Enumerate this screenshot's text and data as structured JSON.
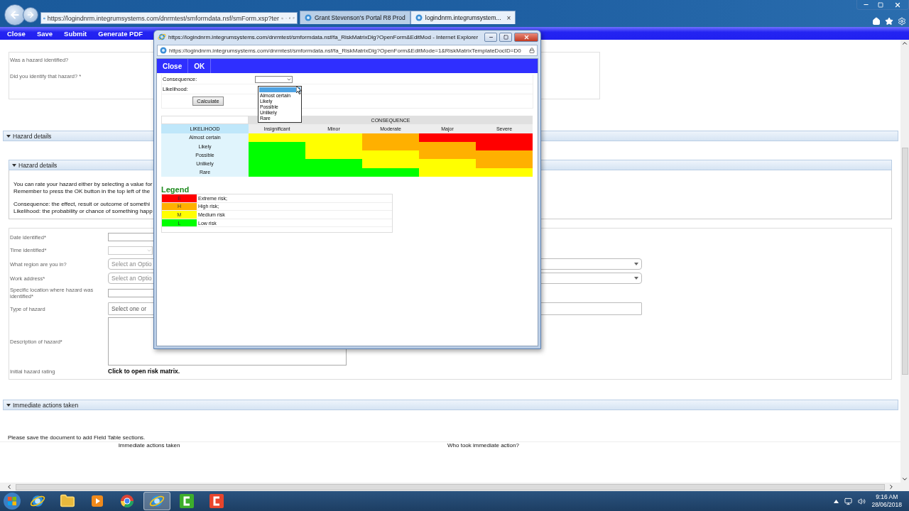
{
  "browser": {
    "address": "https://logindnrm.integrumsystems.com/dnrmtest/smformdata.nsf/smForm.xsp?ter",
    "tabs": [
      {
        "label": "Grant Stevenson's Portal R8 Prod",
        "selected": false
      },
      {
        "label": "logindnrm.integrumsystem...",
        "selected": true
      }
    ],
    "tab_close": "×"
  },
  "toolbar": [
    "Close",
    "Save",
    "Submit",
    "Generate PDF"
  ],
  "page": {
    "questions": [
      "Was a hazard identified?",
      "Did you identify that hazard? *"
    ],
    "section_title": "Hazard details",
    "subsection_title": "Hazard details",
    "help_lines": [
      "You can rate your hazard either by selecting a value for",
      "Remember to press the OK button in the top left of the",
      "Consequence:   the effect, result or outcome of somethi",
      "Likelihood:  the probability or chance of something happ"
    ],
    "fields": [
      {
        "kind": "text",
        "label": "Date identified*"
      },
      {
        "kind": "time",
        "label": "Time identified*"
      },
      {
        "kind": "select",
        "label": "What region are you in?",
        "placeholder": "Select an Optio"
      },
      {
        "kind": "select",
        "label": "Work address*",
        "placeholder": "Select an Optio"
      },
      {
        "kind": "text",
        "label": "Specific location where hazard was identified*"
      },
      {
        "kind": "multi",
        "label": "Type of hazard",
        "placeholder": "Select one or"
      },
      {
        "kind": "textarea",
        "label": "Description of hazard*"
      },
      {
        "kind": "link",
        "label": "Initial hazard rating",
        "value": "Click to open risk matrix."
      }
    ],
    "actions": {
      "title": "Immediate actions taken",
      "note": "Please save the document to add Field Table sections.",
      "columns": [
        "Immediate actions taken",
        "Who took immediate action?"
      ]
    }
  },
  "dialog": {
    "title": "https://logindnrm.integrumsystems.com/dnrmtest/smformdata.nsf/fa_RiskMatrixDlg?OpenForm&EditMod - Internet Explorer",
    "address": "https://logindnrm.integrumsystems.com/dnrmtest/smformdata.nsf/fa_RiskMatrixDlg?OpenForm&EditMode=1&RiskMatrixTemplateDocID=D0",
    "toolbar": [
      "Close",
      "OK"
    ],
    "consequence_label": "Consequence:",
    "likelihood_label": "Likelihood:",
    "likelihood_options": [
      {
        "label": "Almost certain",
        "selected": false
      },
      {
        "label": "Likely",
        "selected": false
      },
      {
        "label": "Possible",
        "selected": false
      },
      {
        "label": "Unlikely",
        "selected": false
      },
      {
        "label": "Rare",
        "selected": false
      }
    ],
    "calculate": "Calculate",
    "matrix": {
      "axis_title": "CONSEQUENCE",
      "row_header": "LIKELIHOOD",
      "columns": [
        "Insignificant",
        "Minor",
        "Moderate",
        "Major",
        "Severe"
      ],
      "rows": [
        {
          "label": "Almost certain",
          "cells": [
            {
              "color": "#ffff00"
            },
            {
              "color": "#ffff00"
            },
            {
              "color": "#ffb000"
            },
            {
              "color": "#ff0000"
            },
            {
              "color": "#ff0000"
            }
          ]
        },
        {
          "label": "Likely",
          "cells": [
            {
              "color": "#00ff00"
            },
            {
              "color": "#ffff00"
            },
            {
              "color": "#ffb000"
            },
            {
              "color": "#ffb000"
            },
            {
              "color": "#ff0000"
            }
          ]
        },
        {
          "label": "Possible",
          "cells": [
            {
              "color": "#00ff00"
            },
            {
              "color": "#ffff00"
            },
            {
              "color": "#ffff00"
            },
            {
              "color": "#ffb000"
            },
            {
              "color": "#ffb000"
            }
          ]
        },
        {
          "label": "Unlikely",
          "cells": [
            {
              "color": "#00ff00"
            },
            {
              "color": "#00ff00"
            },
            {
              "color": "#ffff00"
            },
            {
              "color": "#ffff00"
            },
            {
              "color": "#ffb000"
            }
          ]
        },
        {
          "label": "Rare",
          "cells": [
            {
              "color": "#00ff00"
            },
            {
              "color": "#00ff00"
            },
            {
              "color": "#00ff00"
            },
            {
              "color": "#ffff00"
            },
            {
              "color": "#ffff00"
            }
          ]
        }
      ]
    },
    "legend_title": "Legend",
    "legend": [
      {
        "code": "E",
        "label": "Extreme risk;",
        "color": "#ff0000"
      },
      {
        "code": "H",
        "label": "High risk;",
        "color": "#ffb000"
      },
      {
        "code": "M",
        "label": "Medium risk",
        "color": "#ffff00"
      },
      {
        "code": "L",
        "label": "Low risk",
        "color": "#00ff00"
      }
    ]
  },
  "taskbar": {
    "apps": [
      {
        "kind": "ie",
        "selected": false
      },
      {
        "kind": "folder",
        "selected": false
      },
      {
        "kind": "media",
        "selected": false
      },
      {
        "kind": "chrome",
        "selected": false
      },
      {
        "kind": "ie",
        "selected": true
      },
      {
        "kind": "green",
        "selected": false
      },
      {
        "kind": "red",
        "selected": false
      }
    ],
    "time": "9:16 AM",
    "date": "28/06/2018"
  }
}
